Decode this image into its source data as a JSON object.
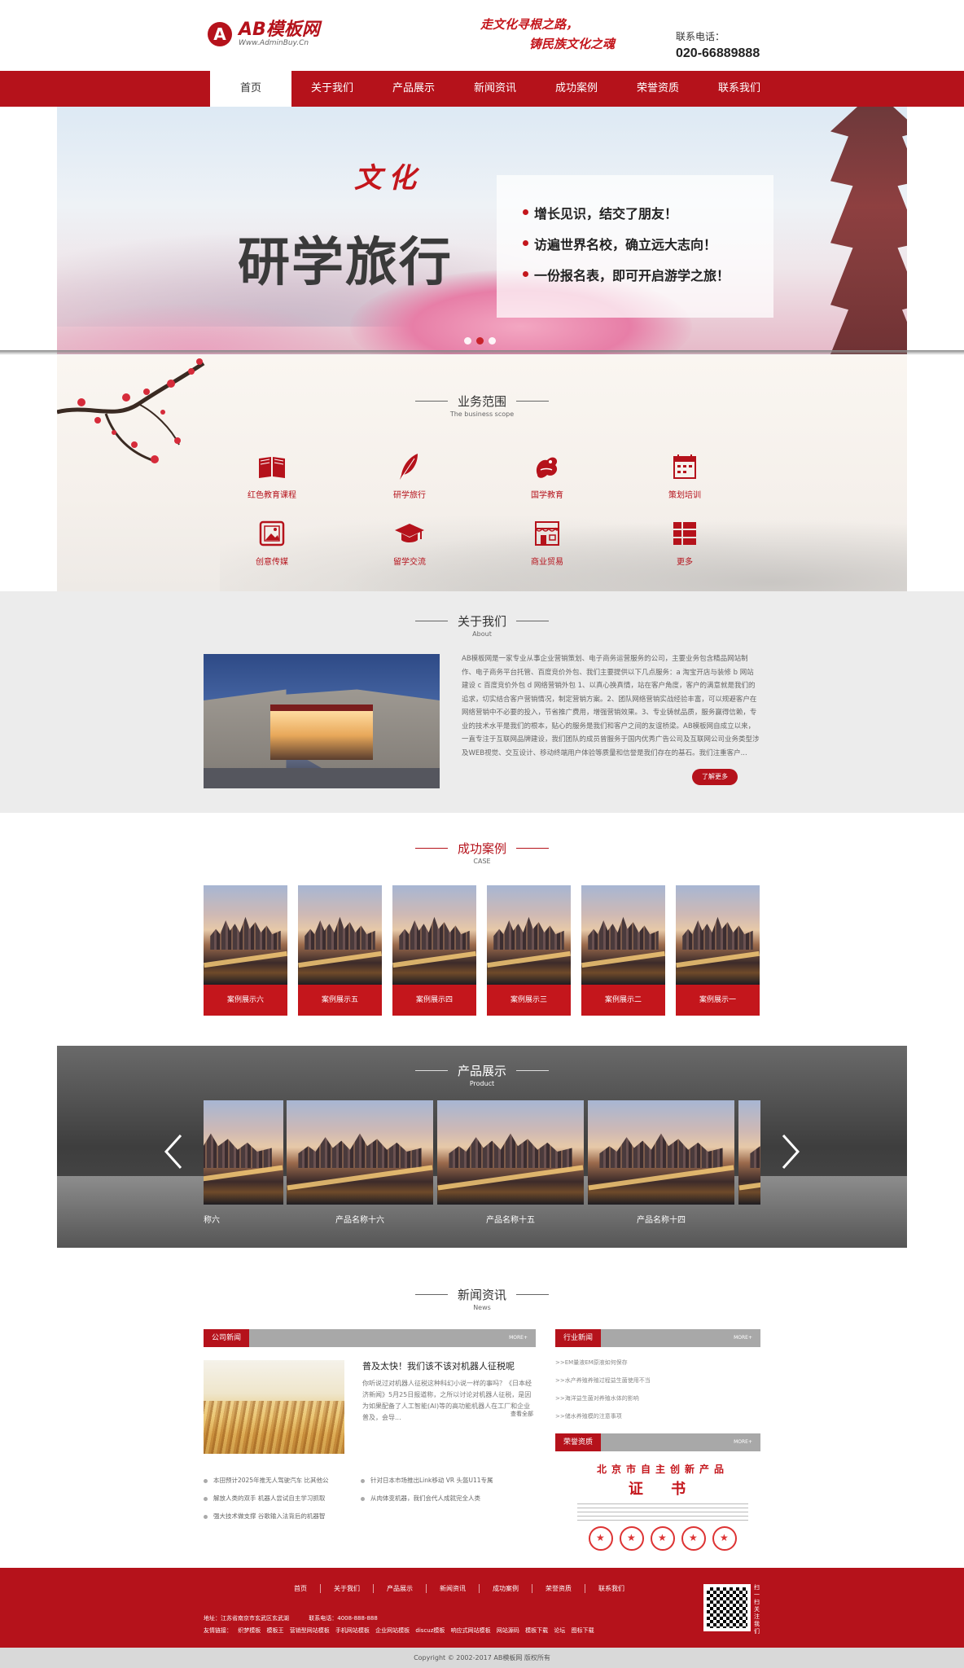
{
  "header": {
    "logo_mark": "A",
    "logo_name": "AB模板网",
    "logo_sub": "Www.AdminBuy.Cn",
    "slogan_line1": "走文化寻根之路，",
    "slogan_line2": "铸民族文化之魂",
    "contact_label": "联系电话：",
    "contact_phone": "020-66889888"
  },
  "nav": [
    {
      "label": "首页",
      "active": true
    },
    {
      "label": "关于我们"
    },
    {
      "label": "产品展示"
    },
    {
      "label": "新闻资讯"
    },
    {
      "label": "成功案例"
    },
    {
      "label": "荣誉资质"
    },
    {
      "label": "联系我们"
    }
  ],
  "banner": {
    "culture": "文化",
    "headline": "研学旅行",
    "points": [
      "增长见识，结交了朋友！",
      "访遍世界名校，确立远大志向！",
      "一份报名表，即可开启游学之旅！"
    ],
    "active_dot": 2
  },
  "scope": {
    "title": "业务范围",
    "subtitle": "The business scope",
    "items": [
      {
        "label": "红色教育课程",
        "icon": "book-icon"
      },
      {
        "label": "研学旅行",
        "icon": "feather-icon"
      },
      {
        "label": "国学教育",
        "icon": "dragon-icon"
      },
      {
        "label": "策划培训",
        "icon": "calendar-icon"
      },
      {
        "label": "创意传媒",
        "icon": "image-icon"
      },
      {
        "label": "留学交流",
        "icon": "graduation-cap-icon"
      },
      {
        "label": "商业贸易",
        "icon": "storefront-icon"
      },
      {
        "label": "更多",
        "icon": "list-icon"
      }
    ]
  },
  "about": {
    "title": "关于我们",
    "subtitle": "About",
    "text": "AB模板网是一家专业从事企业营销策划、电子商务运营服务的公司，主要业务包含精品网站制作、电子商务平台托管、百度竞价外包、我们主要提供以下几点服务：a 淘宝开店与装修 b 网站建设 c 百度竞价外包 d 网络营销外包 1、以真心换真情，站在客户角度，客户的满意就是我们的追求，切实结合客户营销情况，制定营销方案。2、团队网络营销实战经验丰富，可以规避客户在网络营销中不必要的投入，节省推广费用，增强营销效果。3、专业铸就品质，服务赢得信赖，专业的技术水平是我们的根本，贴心的服务是我们和客户之间的友谊桥梁。AB模板网自成立以来，一直专注于互联网品牌建设，我们团队的成员曾服务于国内优秀广告公司及互联网公司业务类型涉及WEB视觉、交互设计、移动终端用户体验等质量和信誉是我们存在的基石。我们注重客户...",
    "more": "了解更多"
  },
  "cases": {
    "title": "成功案例",
    "subtitle": "CASE",
    "items": [
      "案例展示六",
      "案例展示五",
      "案例展示四",
      "案例展示三",
      "案例展示二",
      "案例展示一"
    ]
  },
  "products": {
    "title": "产品展示",
    "subtitle": "Product",
    "items": [
      "产品名称六",
      "产品名称十六",
      "产品名称十五",
      "产品名称十四"
    ],
    "partial_first_caption": "品名称六"
  },
  "news": {
    "title": "新闻资讯",
    "subtitle": "News",
    "company_tab": "公司新闻",
    "more": "MORE+",
    "featured": {
      "title": "普及太快！我们该不该对机器人征税呢",
      "body": "你听说过对机器人征税这种科幻小说一样的事吗？《日本经济新闻》5月25日报道称，之所以讨论对机器人征税，是因为如果配备了人工智能(AI)等的高功能机器人在工厂和企业普及，会导...",
      "more": "查看全部"
    },
    "list_left": [
      "本田预计2025年推无人驾驶汽车 比其他公",
      "解放人类的双手 机器人尝试自主学习抓取",
      "强大技术做支撑 谷歌输入法背后的机器智"
    ],
    "list_right": [
      "针对日本市场推出Link移动 VR 头盔U11专属",
      "从肉体变机器，我们会代人成就完全人类"
    ],
    "industry_tab": "行业新闻",
    "industry": [
      ">>EM量液EM原液如何保存",
      ">>水产养殖养殖过程益生菌使用不当",
      ">>海洋益生菌对养殖水体的影响",
      ">>储水养殖模的注意事项"
    ],
    "honor_tab": "荣誉资质",
    "cert_line1": "北京市自主创新产品",
    "cert_line2": "证 书"
  },
  "footer": {
    "nav": [
      "首页",
      "关于我们",
      "产品展示",
      "新闻资讯",
      "成功案例",
      "荣誉资质",
      "联系我们"
    ],
    "address": "地址：江苏省南京市玄武区玄武湖",
    "phone": "联系电话：4008-888-888",
    "links_label": "友情链接：",
    "links": [
      "织梦模板",
      "模板王",
      "营销型网站模板",
      "手机网站模板",
      "企业网站模板",
      "discuz模板",
      "响应式网站模板",
      "网站源码",
      "模板下载",
      "论坛",
      "图标下载"
    ],
    "qr_text": "扫一扫关注我们",
    "copyright": "Copyright © 2002-2017 AB模板网 版权所有"
  }
}
